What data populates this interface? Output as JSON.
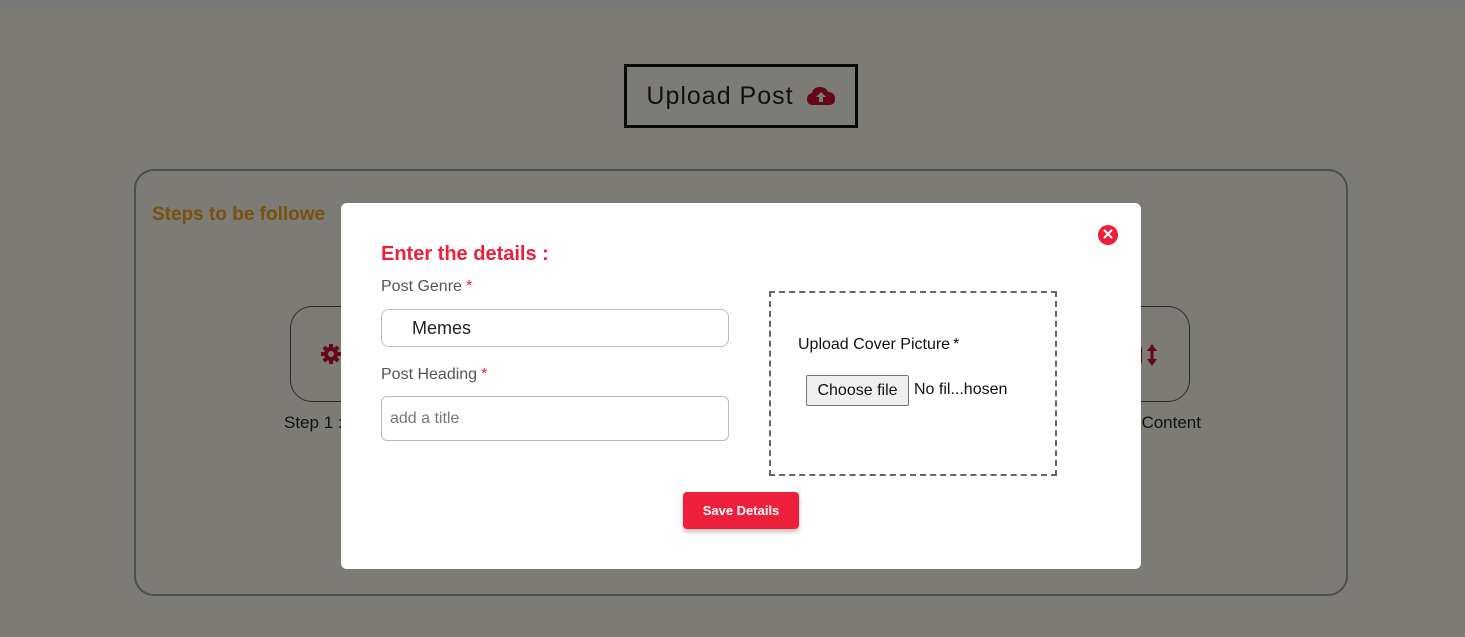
{
  "page": {
    "upload_post_label": "Upload Post",
    "steps_title": "Steps to be followe",
    "step1_label": "Step 1 :",
    "step_last_label": ": Content"
  },
  "modal": {
    "title": "Enter the details :",
    "genre_label": "Post Genre",
    "genre_value": "Memes",
    "heading_label": "Post Heading",
    "heading_placeholder": "add a title",
    "required_mark": "*",
    "upload_label": "Upload Cover Picture",
    "choose_file_label": "Choose file",
    "file_status": "No fil...hosen",
    "save_label": "Save Details"
  },
  "colors": {
    "accent": "#ee1f3b",
    "steps_title": "#f0a020",
    "page_background": "#fbf6ec"
  },
  "icons": {
    "upload": "cloud-upload-icon",
    "close": "close-icon",
    "step1": "gear-icon",
    "step_last": "arrows-vertical-icon"
  }
}
